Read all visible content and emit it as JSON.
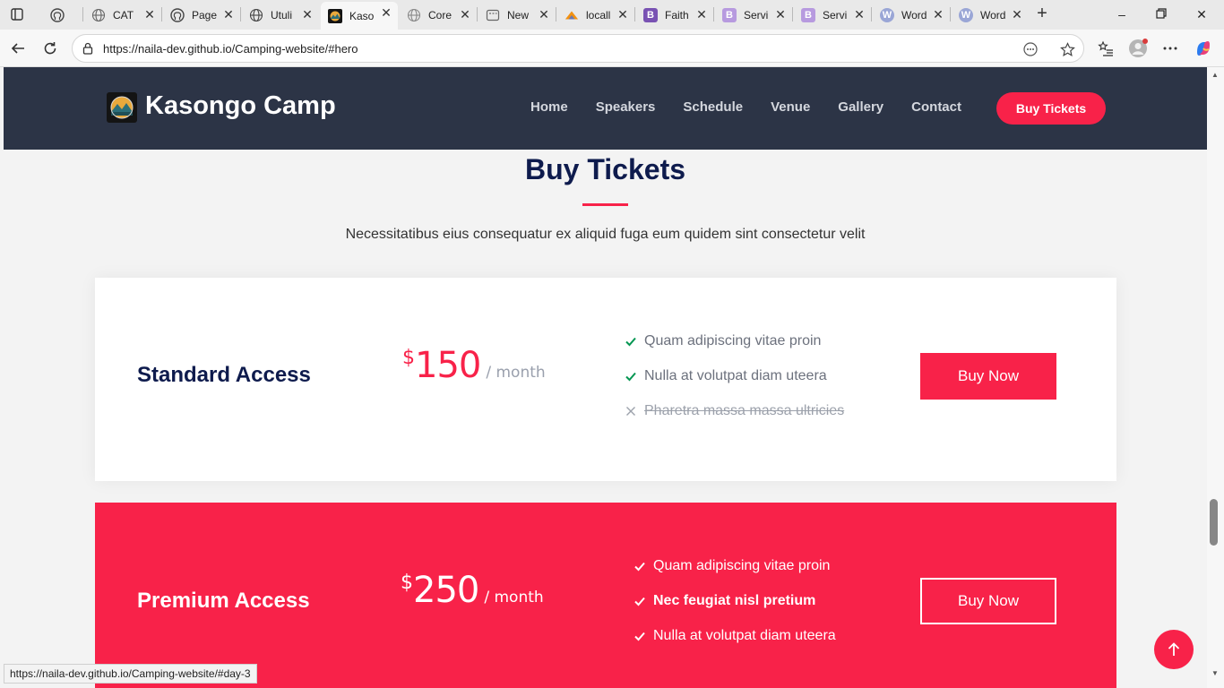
{
  "browser": {
    "tabs": [
      {
        "title": "",
        "icon": "github-icon",
        "color": "#444444"
      },
      {
        "title": "CAT",
        "icon": "globe-icon",
        "color": "#666666"
      },
      {
        "title": "Page",
        "icon": "github-icon",
        "color": "#444444"
      },
      {
        "title": "Utuli",
        "icon": "globe-icon",
        "color": "#444444"
      },
      {
        "title": "Kaso",
        "icon": "camp-logo-icon",
        "color": "#141414",
        "active": true
      },
      {
        "title": "Core",
        "icon": "globe-icon",
        "color": "#888888"
      },
      {
        "title": "New",
        "icon": "newtab-icon",
        "color": "#666666"
      },
      {
        "title": "locall",
        "icon": "phpmyadmin-icon",
        "color": "#f29111"
      },
      {
        "title": "Faith",
        "icon": "bootstrap-icon",
        "color": "#7952b3",
        "glyph": "B"
      },
      {
        "title": "Servi",
        "icon": "bootstrap-icon",
        "color": "#b79adf",
        "glyph": "B"
      },
      {
        "title": "Servi",
        "icon": "bootstrap-icon",
        "color": "#b79adf",
        "glyph": "B"
      },
      {
        "title": "Word",
        "icon": "wordpress-icon",
        "color": "#9aa6d6",
        "glyph": "W"
      },
      {
        "title": "Word",
        "icon": "wordpress-icon",
        "color": "#9aa6d6",
        "glyph": "W"
      }
    ],
    "url": "https://naila-dev.github.io/Camping-website/#hero",
    "status_url": "https://naila-dev.github.io/Camping-website/#day-3"
  },
  "site": {
    "brand": "Kasongo Camp",
    "nav": [
      "Home",
      "Speakers",
      "Schedule",
      "Venue",
      "Gallery",
      "Contact"
    ],
    "cta": "Buy Tickets",
    "accent_color": "#f82249",
    "header_color": "#2c3446"
  },
  "tickets": {
    "title": "Buy Tickets",
    "subtitle": "Necessitatibus eius consequatur ex aliquid fuga eum quidem sint consectetur velit",
    "standard": {
      "name": "Standard Access",
      "currency": "$",
      "price": "150",
      "period": "/ month",
      "features": [
        {
          "text": "Quam adipiscing vitae proin",
          "included": true
        },
        {
          "text": "Nulla at volutpat diam uteera",
          "included": true
        },
        {
          "text": "Pharetra massa massa ultricies",
          "included": false
        }
      ],
      "button": "Buy Now"
    },
    "premium": {
      "name": "Premium Access",
      "currency": "$",
      "price": "250",
      "period": "/ month",
      "features": [
        {
          "text": "Quam adipiscing vitae proin",
          "included": true
        },
        {
          "text": "Nec feugiat nisl pretium",
          "included": true,
          "bold": true
        },
        {
          "text": "Nulla at volutpat diam uteera",
          "included": true
        }
      ],
      "button": "Buy Now"
    }
  }
}
